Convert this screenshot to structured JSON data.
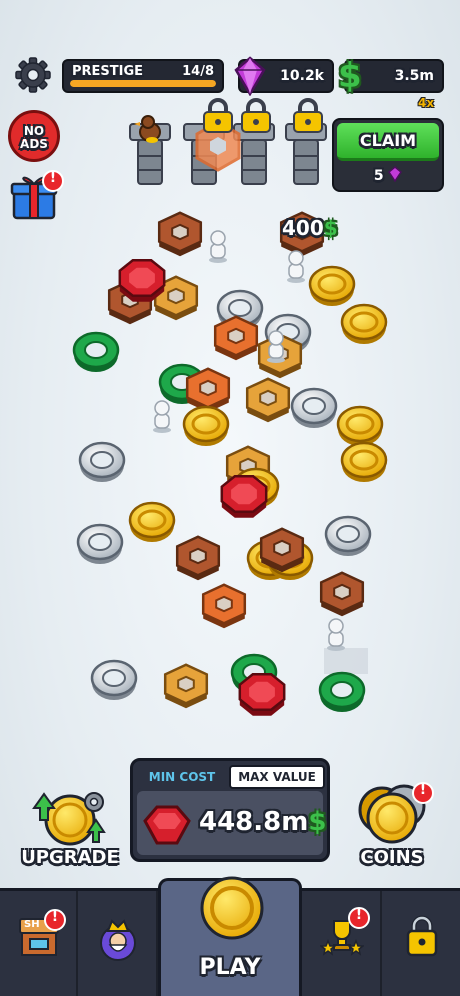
{
  "hud": {
    "prestige_label": "PRESTIGE",
    "prestige_count": "14/8",
    "prestige_progress": 1.0,
    "gems": "10.2k",
    "cash": "3.5m",
    "multiplier": "4x"
  },
  "left_buttons": {
    "no_ads_label": "NO ADS"
  },
  "claim": {
    "label": "CLAIM",
    "cost": "5"
  },
  "popup": {
    "value": "400",
    "currency": "$"
  },
  "cost_panel": {
    "tab_min": "MIN COST",
    "tab_max": "MAX VALUE",
    "amount": "448.8m",
    "currency": "$"
  },
  "actions": {
    "upgrade_label": "UPGRADE",
    "coins_label": "COINS"
  },
  "nav": {
    "play_label": "PLAY",
    "shop_sign": "SH"
  },
  "colors": {
    "accent_orange": "#f5a623",
    "claim_green": "#2fb22c",
    "cash_green": "#3cc04a",
    "gem_purple": "#c23bd8",
    "panel_dark": "#2c3140"
  }
}
